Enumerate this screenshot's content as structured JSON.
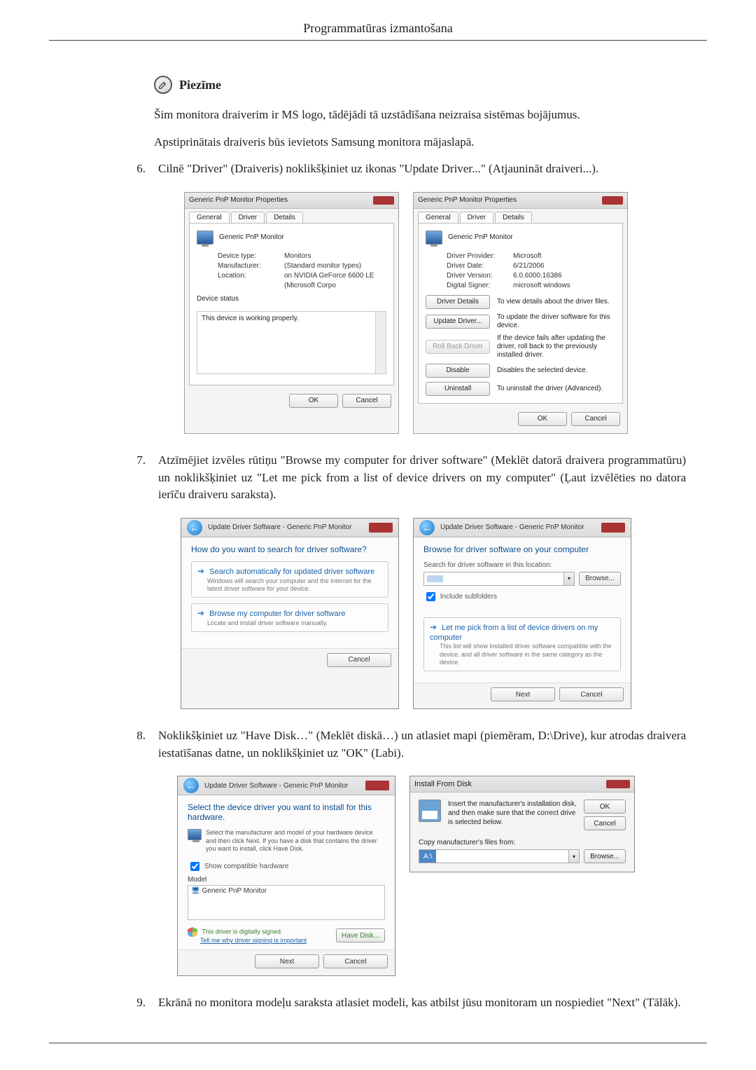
{
  "page_header": "Programmatūras izmantošana",
  "note_label": "Piezīme",
  "note_body_1": "Šim monitora draiverim ir MS logo, tādējādi tā uzstādīšana neizraisa sistēmas bojājumus.",
  "note_body_2": "Apstiprinātais draiveris būs ievietots Samsung monitora mājaslapā.",
  "step6_num": "6.",
  "step6_text": "Cilnē \"Driver\" (Draiveris) noklikšķiniet uz ikonas \"Update Driver...\" (Atjaunināt draiveri...).",
  "step7_num": "7.",
  "step7_text": "Atzīmējiet izvēles rūtiņu \"Browse my computer for driver software\" (Meklēt datorā draivera programmatūru) un noklikšķiniet uz \"Let me pick from a list of device drivers on my computer\" (Ļaut izvēlēties no datora ierīču draiveru saraksta).",
  "step8_num": "8.",
  "step8_text": "Noklikšķiniet uz \"Have Disk…\" (Meklēt diskā…) un atlasiet mapi (piemēram, D:\\Drive), kur atrodas draivera iestatīšanas datne, un noklikšķiniet uz \"OK\" (Labi).",
  "step9_num": "9.",
  "step9_text": "Ekrānā no monitora modeļu saraksta atlasiet modeli, kas atbilst jūsu monitoram un nospiediet \"Next\" (Tālāk).",
  "dlg1": {
    "title": "Generic PnP Monitor Properties",
    "tabs": [
      "General",
      "Driver",
      "Details"
    ],
    "device_name": "Generic PnP Monitor",
    "device_type_label": "Device type:",
    "device_type": "Monitors",
    "manufacturer_label": "Manufacturer:",
    "manufacturer": "(Standard monitor types)",
    "location_label": "Location:",
    "location": "on NVIDIA GeForce 6600 LE (Microsoft Corpo",
    "status_label": "Device status",
    "status_text": "This device is working properly.",
    "ok": "OK",
    "cancel": "Cancel"
  },
  "dlg2": {
    "title": "Generic PnP Monitor Properties",
    "tabs": [
      "General",
      "Driver",
      "Details"
    ],
    "device_name": "Generic PnP Monitor",
    "provider_label": "Driver Provider:",
    "provider": "Microsoft",
    "date_label": "Driver Date:",
    "date": "6/21/2006",
    "version_label": "Driver Version:",
    "version": "6.0.6000.16386",
    "signer_label": "Digital Signer:",
    "signer": "microsoft windows",
    "btn_details": "Driver Details",
    "btn_details_desc": "To view details about the driver files.",
    "btn_update": "Update Driver...",
    "btn_update_desc": "To update the driver software for this device.",
    "btn_rollback": "Roll Back Driver",
    "btn_rollback_desc": "If the device fails after updating the driver, roll back to the previously installed driver.",
    "btn_disable": "Disable",
    "btn_disable_desc": "Disables the selected device.",
    "btn_uninstall": "Uninstall",
    "btn_uninstall_desc": "To uninstall the driver (Advanced).",
    "ok": "OK",
    "cancel": "Cancel"
  },
  "wiz1": {
    "head": "Update Driver Software - Generic PnP Monitor",
    "title": "How do you want to search for driver software?",
    "opt1_title": "Search automatically for updated driver software",
    "opt1_sub": "Windows will search your computer and the Internet for the latest driver software for your device.",
    "opt2_title": "Browse my computer for driver software",
    "opt2_sub": "Locate and install driver software manually.",
    "cancel": "Cancel"
  },
  "wiz2": {
    "head": "Update Driver Software - Generic PnP Monitor",
    "title": "Browse for driver software on your computer",
    "label_loc": "Search for driver software in this location:",
    "browse": "Browse...",
    "include": "Include subfolders",
    "opt_title": "Let me pick from a list of device drivers on my computer",
    "opt_sub": "This list will show installed driver software compatible with the device, and all driver software in the same category as the device.",
    "next": "Next",
    "cancel": "Cancel"
  },
  "wiz3": {
    "head": "Update Driver Software - Generic PnP Monitor",
    "title": "Select the device driver you want to install for this hardware.",
    "note": "Select the manufacturer and model of your hardware device and then click Next. If you have a disk that contains the driver you want to install, click Have Disk.",
    "show_compat": "Show compatible hardware",
    "model_label": "Model",
    "model_item": "Generic PnP Monitor",
    "signed": "This driver is digitally signed.",
    "signed_link": "Tell me why driver signing is important",
    "have_disk": "Have Disk...",
    "next": "Next",
    "cancel": "Cancel"
  },
  "ifd": {
    "title": "Install From Disk",
    "msg": "Insert the manufacturer's installation disk, and then make sure that the correct drive is selected below.",
    "ok": "OK",
    "cancel": "Cancel",
    "copy_label": "Copy manufacturer's files from:",
    "path": "A:\\",
    "browse": "Browse..."
  }
}
